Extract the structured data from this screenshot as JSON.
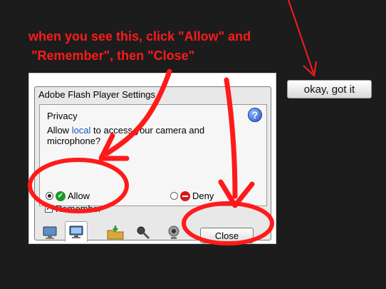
{
  "instruction": {
    "line1": "when you see this, click \"Allow\" and",
    "line2": "\"Remember\", then \"Close\""
  },
  "ack_button": {
    "label": "okay, got it"
  },
  "flash_dialog": {
    "title": "Adobe Flash Player Settings",
    "privacy": {
      "heading": "Privacy",
      "help_symbol": "?",
      "text_before_link": "Allow ",
      "link_text": "local",
      "text_after_link": " to access your camera and microphone?",
      "allow_label": "Allow",
      "deny_label": "Deny",
      "remember_label": "Remember",
      "remember_checked": true,
      "allow_selected": true
    },
    "tabs": [
      {
        "icon": "monitor-icon"
      },
      {
        "icon": "monitor-screen-icon",
        "active": true
      },
      {
        "icon": "folder-download-icon"
      },
      {
        "icon": "microphone-icon"
      },
      {
        "icon": "webcam-icon"
      }
    ],
    "close_label": "Close"
  },
  "colors": {
    "background": "#1c1c1c",
    "annotation_red": "#ff1a1a",
    "link_blue": "#1a56c4",
    "allow_green": "#1a9a2a",
    "deny_red": "#d51a1a"
  }
}
